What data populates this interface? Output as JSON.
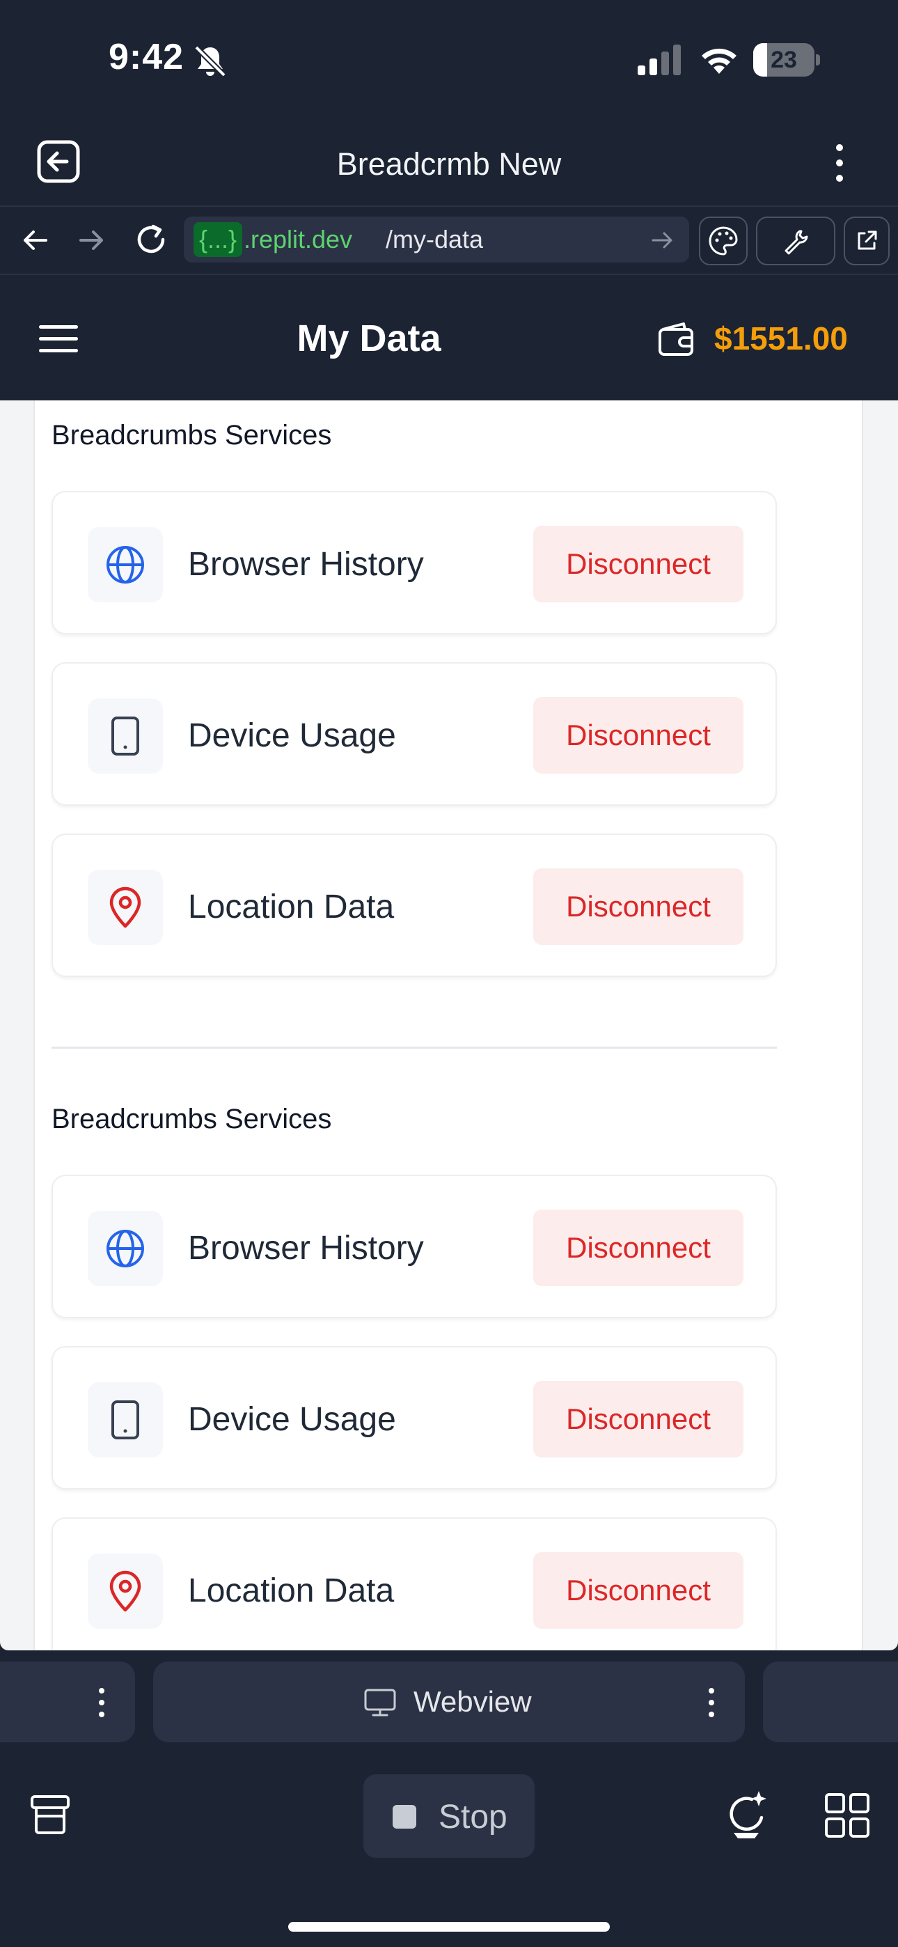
{
  "status_bar": {
    "time": "9:42",
    "battery_level": "23",
    "battery_fraction": 0.23
  },
  "app": {
    "title": "Breadcrmb New"
  },
  "url_bar": {
    "domain_box": "{...}",
    "domain_rest": ".replit.dev",
    "path": "/my-data"
  },
  "header": {
    "title": "My Data",
    "balance": "$1551.00"
  },
  "sections": [
    {
      "title": "Breadcrumbs Services",
      "items": [
        {
          "label": "Browser History",
          "icon": "globe-icon",
          "action": "Disconnect"
        },
        {
          "label": "Device Usage",
          "icon": "tablet-icon",
          "action": "Disconnect"
        },
        {
          "label": "Location Data",
          "icon": "location-pin-icon",
          "action": "Disconnect"
        }
      ]
    },
    {
      "title": "Breadcrumbs Services",
      "items": [
        {
          "label": "Browser History",
          "icon": "globe-icon",
          "action": "Disconnect"
        },
        {
          "label": "Device Usage",
          "icon": "tablet-icon",
          "action": "Disconnect"
        },
        {
          "label": "Location Data",
          "icon": "location-pin-icon",
          "action": "Disconnect"
        }
      ]
    }
  ],
  "tabs": {
    "center_label": "Webview"
  },
  "toolbar": {
    "stop_label": "Stop"
  },
  "colors": {
    "background": "#1c2333",
    "balance": "#f59e0b",
    "disconnect_text": "#dc2626",
    "disconnect_bg": "#fdecec",
    "globe": "#2563eb",
    "location": "#dc2626"
  }
}
